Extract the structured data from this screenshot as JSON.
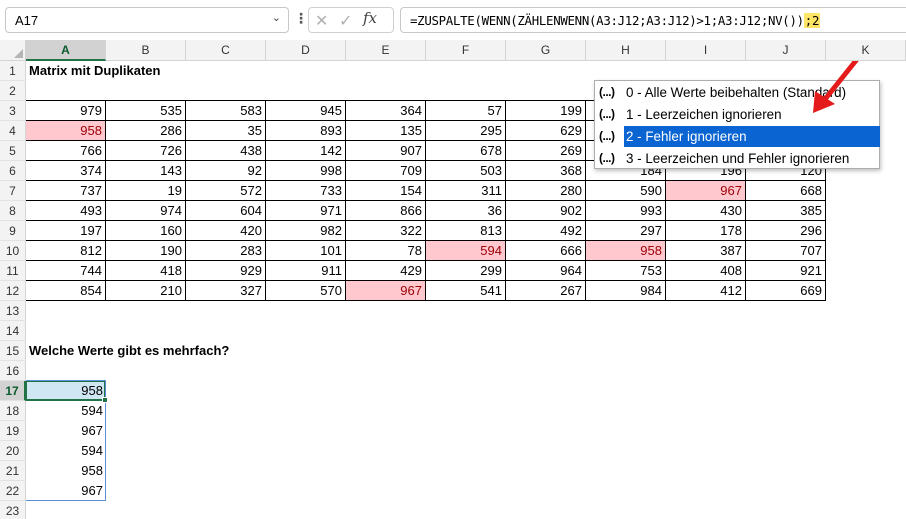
{
  "formula_bar": {
    "name_box": "A17",
    "formula_main": "=ZUSPALTE(WENN(ZÄHLENWENN(A3:J12;A3:J12)>1;A3:J12;NV())",
    "formula_highlight": ";2",
    "fx_label": "fx"
  },
  "columns": [
    "A",
    "B",
    "C",
    "D",
    "E",
    "F",
    "G",
    "H",
    "I",
    "J",
    "K"
  ],
  "rows": [
    "1",
    "2",
    "3",
    "4",
    "5",
    "6",
    "7",
    "8",
    "9",
    "10",
    "11",
    "12",
    "13",
    "14",
    "15",
    "16",
    "17",
    "18",
    "19",
    "20",
    "21",
    "22",
    "23"
  ],
  "sheet": {
    "title1": "Matrix mit Duplikaten",
    "title2": "Welche Werte gibt es mehrfach?",
    "matrix": [
      [
        "979",
        "535",
        "583",
        "945",
        "364",
        "57",
        "199",
        "",
        "",
        ""
      ],
      [
        "958",
        "286",
        "35",
        "893",
        "135",
        "295",
        "629",
        "",
        "",
        ""
      ],
      [
        "766",
        "726",
        "438",
        "142",
        "907",
        "678",
        "269",
        "",
        "",
        ""
      ],
      [
        "374",
        "143",
        "92",
        "998",
        "709",
        "503",
        "368",
        "184",
        "196",
        "120"
      ],
      [
        "737",
        "19",
        "572",
        "733",
        "154",
        "311",
        "280",
        "590",
        "967",
        "668"
      ],
      [
        "493",
        "974",
        "604",
        "971",
        "866",
        "36",
        "902",
        "993",
        "430",
        "385"
      ],
      [
        "197",
        "160",
        "420",
        "982",
        "322",
        "813",
        "492",
        "297",
        "178",
        "296"
      ],
      [
        "812",
        "190",
        "283",
        "101",
        "78",
        "594",
        "666",
        "958",
        "387",
        "707"
      ],
      [
        "744",
        "418",
        "929",
        "911",
        "429",
        "299",
        "964",
        "753",
        "408",
        "921"
      ],
      [
        "854",
        "210",
        "327",
        "570",
        "967",
        "541",
        "267",
        "984",
        "412",
        "669"
      ]
    ],
    "duplicates": [
      "958",
      "594",
      "967"
    ],
    "result": [
      "958",
      "594",
      "967",
      "594",
      "958",
      "967"
    ]
  },
  "dropdown": {
    "icon": "(...)",
    "items": [
      "0 - Alle Werte beibehalten (Standard)",
      "1 - Leerzeichen ignorieren",
      "2 - Fehler ignorieren",
      "3 - Leerzeichen und Fehler ignorieren"
    ],
    "selected_index": 2
  },
  "colors": {
    "duplicate_fill": "#ffc7ce",
    "duplicate_text": "#9c0006",
    "selection": "#0a64d2",
    "arrow": "#e51b1b",
    "formula_highlight": "#ffe566"
  }
}
